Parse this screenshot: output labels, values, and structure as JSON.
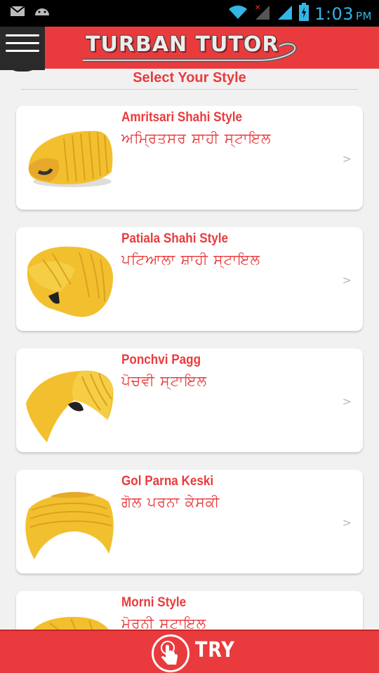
{
  "status_bar": {
    "time": "1:03",
    "ampm": "PM",
    "icons": [
      "gmail-icon",
      "android-icon",
      "wifi-icon",
      "signal-off-icon",
      "signal-icon",
      "battery-charging-icon"
    ]
  },
  "header": {
    "title": "TURBAN TUTOR",
    "menu_icon": "hamburger-menu-icon"
  },
  "page": {
    "subtitle": "Select Your Style"
  },
  "styles": [
    {
      "name": "Amritsari Shahi Style",
      "punjabi": "ਅਮ੍ਰਿਤਸਰ ਸ਼ਾਹੀ ਸ੍ਟਾਇਲ",
      "arrow": ">"
    },
    {
      "name": "Patiala Shahi Style",
      "punjabi": "ਪਟਿਆਲਾ ਸ਼ਾਹੀ ਸ੍ਟਾਇਲ",
      "arrow": ">"
    },
    {
      "name": "Ponchvi Pagg",
      "punjabi": "ਪੋਚਵੀ ਸ੍ਟਾਇਲ",
      "arrow": ">"
    },
    {
      "name": "Gol Parna Keski",
      "punjabi": "ਗੋਲ ਪਰਨਾ ਕੇਸਕੀ",
      "arrow": ">"
    },
    {
      "name": "Morni Style",
      "punjabi": "ਮੋਰਨੀ ਸਟਾਇਲ",
      "arrow": ">"
    }
  ],
  "bottom": {
    "try_label": "TRY",
    "icon": "touch-hand-icon"
  },
  "colors": {
    "accent": "#e93b3d",
    "turban": "#f2c02e",
    "status_icon": "#33b5e5"
  }
}
